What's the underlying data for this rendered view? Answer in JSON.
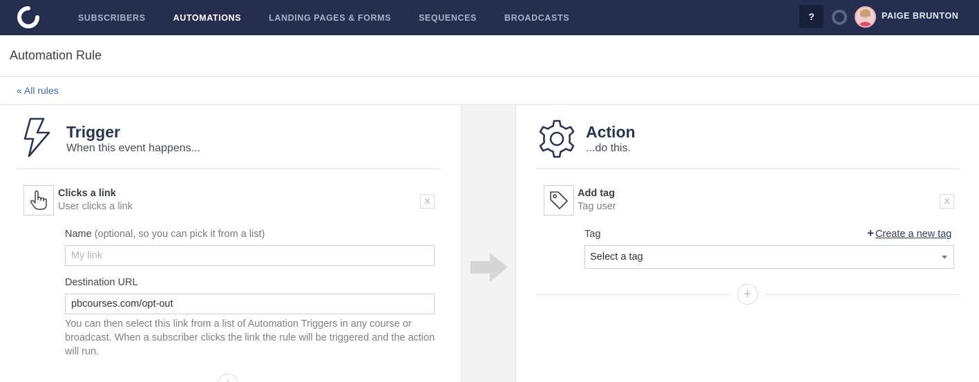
{
  "nav": {
    "links": [
      {
        "label": "SUBSCRIBERS",
        "active": false
      },
      {
        "label": "AUTOMATIONS",
        "active": true
      },
      {
        "label": "LANDING PAGES & FORMS",
        "active": false
      },
      {
        "label": "SEQUENCES",
        "active": false
      },
      {
        "label": "BROADCASTS",
        "active": false
      }
    ],
    "help_label": "?",
    "user_name": "PAIGE BRUNTON",
    "colors": {
      "bar": "#262e4f",
      "link": "#a9b1c9",
      "active_link": "#ffffff"
    }
  },
  "page": {
    "title": "Automation Rule",
    "back_link": "« All rules"
  },
  "trigger": {
    "icon": "lightning-bolt-icon",
    "title": "Trigger",
    "subtitle": "When this event happens...",
    "item": {
      "icon": "pointing-hand-icon",
      "title": "Clicks a link",
      "subtitle": "User clicks a link",
      "close_label": "X"
    },
    "name_label": "Name",
    "name_hint": "(optional, so you can pick it from a list)",
    "name_placeholder": "My link",
    "name_value": "",
    "url_label": "Destination URL",
    "url_value": "pbcourses.com/opt-out",
    "help_text": "You can then select this link from a list of Automation Triggers in any course or broadcast. When a subscriber clicks the link the rule will be triggered and the action will run.",
    "add_label": "+"
  },
  "action": {
    "icon": "gear-icon",
    "title": "Action",
    "subtitle": "...do this.",
    "item": {
      "icon": "tag-icon",
      "title": "Add tag",
      "subtitle": "Tag user",
      "close_label": "X"
    },
    "tag_label": "Tag",
    "create_tag_plus": "+",
    "create_tag_label": "Create a new tag",
    "select_value": "Select a tag",
    "add_label": "+"
  }
}
